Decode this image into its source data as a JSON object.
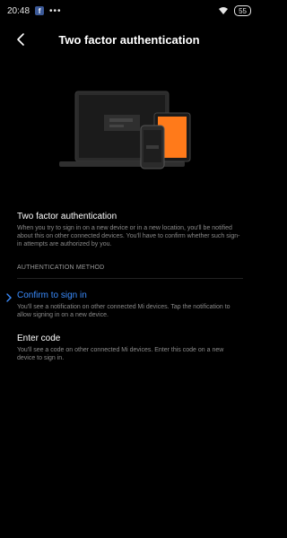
{
  "status_bar": {
    "time": "20:48",
    "fb_icon_label": "f",
    "dots": "•••",
    "battery_level": "55"
  },
  "header": {
    "title": "Two factor authentication",
    "back_icon": "chevron-left-icon"
  },
  "intro": {
    "title": "Two factor authentication",
    "description": "When you try to sign in on a new device or in a new location, you'll be notified about this on other connected devices. You'll have to confirm whether such sign-in attempts are authorized by you."
  },
  "method": {
    "label": "AUTHENTICATION METHOD",
    "options": [
      {
        "title": "Confirm to sign in",
        "description": "You'll see a notification on other connected Mi devices. Tap the notification to allow signing in on a new device.",
        "selected": true
      },
      {
        "title": "Enter code",
        "description": "You'll see a code on other connected Mi devices. Enter this code on a new device to sign in.",
        "selected": false
      }
    ]
  },
  "colors": {
    "accent": "#3b8dff",
    "tablet_screen": "#ff7a1a",
    "background": "#000000"
  }
}
